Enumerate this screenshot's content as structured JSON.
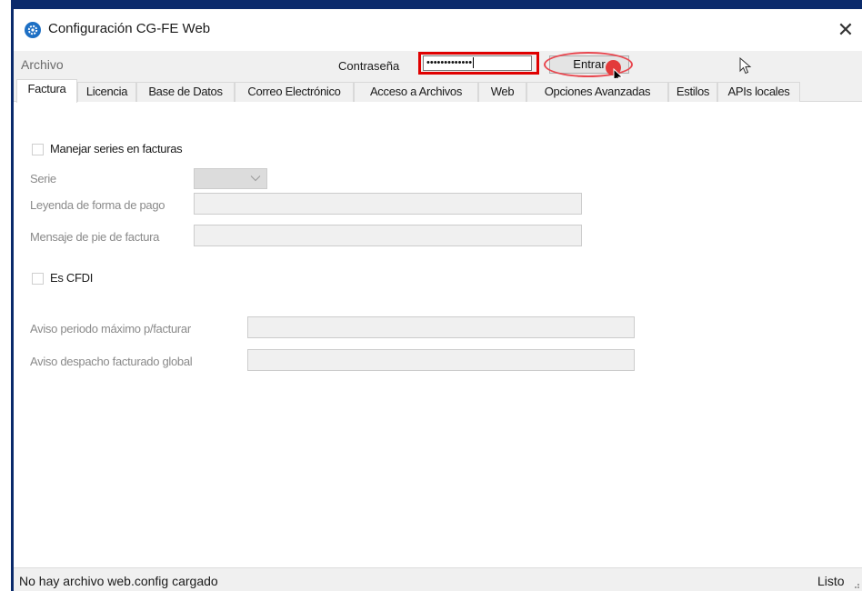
{
  "window": {
    "title": "Configuración CG-FE Web",
    "close_glyph": "✕",
    "app_icon": "gear-icon"
  },
  "toolbar": {
    "menu_archivo": "Archivo",
    "password_label": "Contraseña",
    "password_value": "•••••••••••••",
    "enter_button": "Entrar"
  },
  "tabs": [
    {
      "label": "Factura",
      "active": true
    },
    {
      "label": "Licencia"
    },
    {
      "label": "Base de Datos"
    },
    {
      "label": "Correo Electrónico"
    },
    {
      "label": "Acceso a Archivos"
    },
    {
      "label": "Web"
    },
    {
      "label": "Opciones Avanzadas"
    },
    {
      "label": "Estilos"
    },
    {
      "label": "APIs locales"
    }
  ],
  "form": {
    "manejar_series": {
      "label": "Manejar series en facturas",
      "checked": false
    },
    "serie_label": "Serie",
    "leyenda_label": "Leyenda de forma de pago",
    "leyenda_value": "",
    "mensaje_label": "Mensaje de pie de factura",
    "mensaje_value": "",
    "es_cfdi": {
      "label": "Es CFDI",
      "checked": false
    },
    "aviso_periodo_label": "Aviso periodo máximo p/facturar",
    "aviso_periodo_value": "",
    "aviso_despacho_label": "Aviso despacho facturado global",
    "aviso_despacho_value": ""
  },
  "status": {
    "left": "No hay archivo web.config cargado",
    "right": "Listo"
  },
  "colors": {
    "highlight_box": "#e00000",
    "click_marker": "#e33b3b",
    "frame": "#0a2a6b",
    "icon_blue": "#1d6fc4"
  }
}
